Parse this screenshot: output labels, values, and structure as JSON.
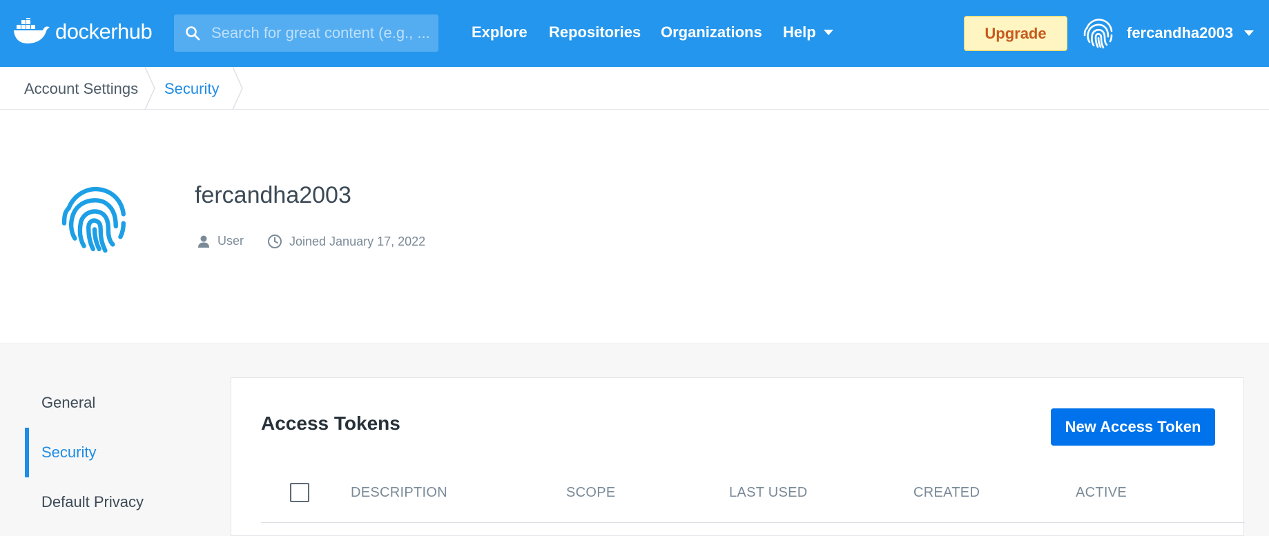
{
  "header": {
    "logo_text_1": "docker",
    "logo_text_2": "hub",
    "search_placeholder": "Search for great content (e.g., ...",
    "nav": [
      "Explore",
      "Repositories",
      "Organizations",
      "Help"
    ],
    "upgrade_label": "Upgrade",
    "username": "fercandha2003"
  },
  "breadcrumb": [
    "Account Settings",
    "Security"
  ],
  "profile": {
    "name": "fercandha2003",
    "role": "User",
    "joined": "Joined January 17, 2022"
  },
  "sidebar": {
    "items": [
      {
        "label": "General"
      },
      {
        "label": "Security",
        "active": true
      },
      {
        "label": "Default Privacy"
      }
    ]
  },
  "tokens": {
    "title": "Access Tokens",
    "new_button": "New Access Token",
    "columns": [
      "DESCRIPTION",
      "SCOPE",
      "LAST USED",
      "CREATED",
      "ACTIVE"
    ]
  },
  "colors": {
    "brand_blue": "#2496ed",
    "primary_button": "#0073ec",
    "upgrade_bg": "#fef5c3",
    "upgrade_text": "#c75a1c",
    "active_link": "#1f8ce6"
  }
}
